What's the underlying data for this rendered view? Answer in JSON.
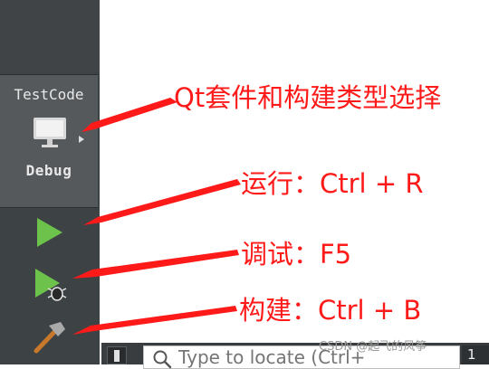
{
  "sidebar": {
    "kit_selector": {
      "project_name": "TestCode",
      "build_config": "Debug"
    },
    "run_icon": "run-icon",
    "debug_icon": "debug-icon",
    "build_icon": "build-hammer-icon"
  },
  "locator": {
    "placeholder": "Type to locate (Ctrl+",
    "tab_number": "1"
  },
  "annotations": {
    "kit": "Qt套件和构建类型选择",
    "run": "运行：Ctrl + R",
    "debug": "调试：F5",
    "build": "构建：Ctrl + B"
  },
  "watermark": "CSDN @起飞的风筝",
  "colors": {
    "annotation_red": "#ff1a1a",
    "sidebar_bg": "#3d4245",
    "run_green": "#6cc24a"
  }
}
